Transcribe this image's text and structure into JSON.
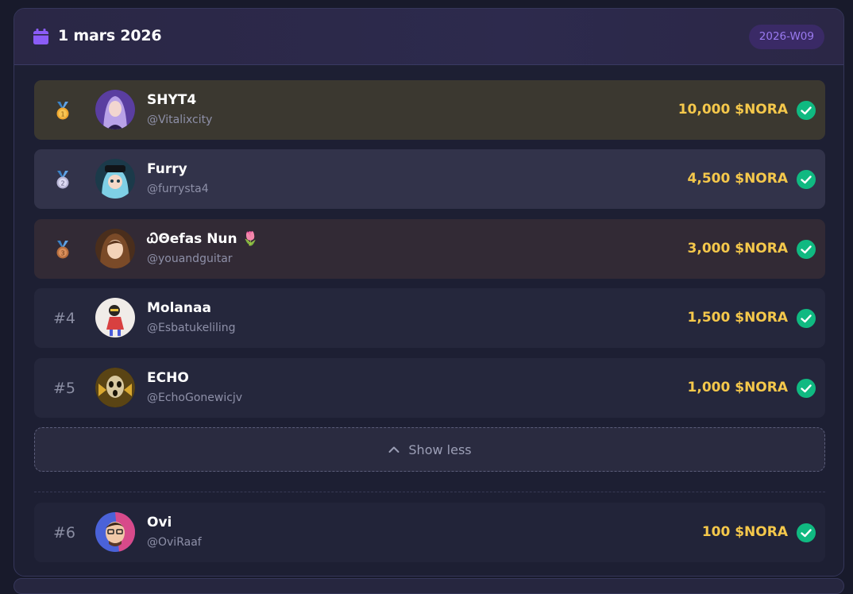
{
  "header": {
    "date": "1 mars 2026",
    "week": "2026-W09",
    "calendar_icon": "calendar-icon"
  },
  "entries": [
    {
      "rank": "1",
      "name": "SHYT4",
      "handle": "@Vitalixcity",
      "amount": "10,000 $NORA",
      "medal": "gold-medal-icon",
      "status": "check-icon"
    },
    {
      "rank": "2",
      "name": "Furry",
      "handle": "@furrysta4",
      "amount": "4,500 $NORA",
      "medal": "silver-medal-icon",
      "status": "check-icon"
    },
    {
      "rank": "3",
      "name": "ᏇΘefas Nun 🌷",
      "handle": "@youandguitar",
      "amount": "3,000 $NORA",
      "medal": "bronze-medal-icon",
      "status": "check-icon"
    },
    {
      "rank": "#4",
      "name": "Molanaa",
      "handle": "@Esbatukeliling",
      "amount": "1,500 $NORA",
      "status": "check-icon"
    },
    {
      "rank": "#5",
      "name": "ECHO",
      "handle": "@EchoGonewicjv",
      "amount": "1,000 $NORA",
      "status": "check-icon"
    },
    {
      "rank": "#6",
      "name": "Ovi",
      "handle": "@OviRaaf",
      "amount": "100 $NORA",
      "status": "check-icon"
    }
  ],
  "toggle": {
    "label": "Show less",
    "icon": "chevron-up-icon"
  },
  "colors": {
    "accent": "#8b5cf6",
    "amount": "#f5c84b",
    "check": "#10b981"
  }
}
